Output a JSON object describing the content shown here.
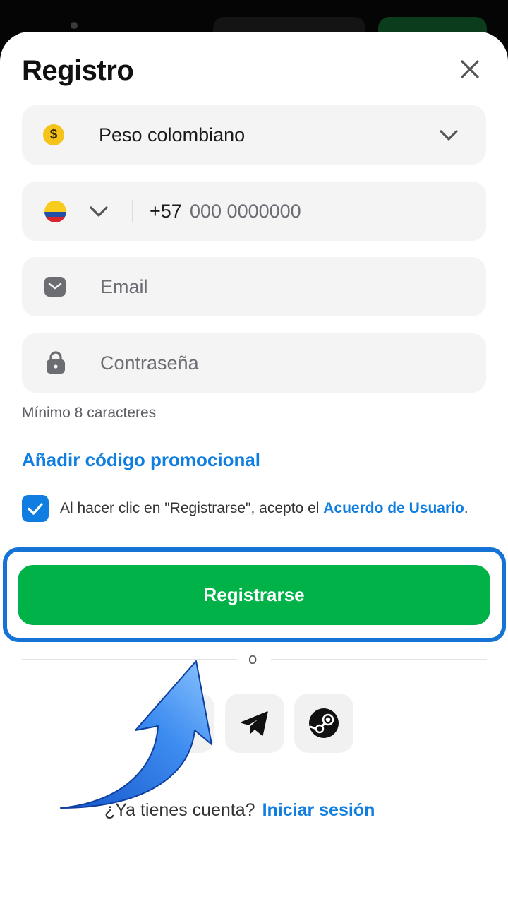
{
  "dialog": {
    "title": "Registro"
  },
  "currency": {
    "value": "Peso colombiano",
    "symbol": "$"
  },
  "phone": {
    "code": "+57",
    "placeholder": "000 0000000"
  },
  "email": {
    "placeholder": "Email"
  },
  "password": {
    "placeholder": "Contraseña",
    "hint": "Mínimo 8 caracteres"
  },
  "promo": {
    "label": "Añadir código promocional"
  },
  "terms": {
    "checked": true,
    "text": "Al hacer clic en \"Registrarse\", acepto el ",
    "link": "Acuerdo de Usuario",
    "end": "."
  },
  "register_button": {
    "label": "Registrarse"
  },
  "divider": {
    "text": "o"
  },
  "social": [
    "telegram-icon",
    "steam-icon"
  ],
  "login": {
    "question": "¿Ya tienes cuenta?",
    "link": "Iniciar sesión"
  },
  "colors": {
    "accent": "#0f7ee0",
    "primary_button": "#00b248",
    "highlight": "#1573d6"
  }
}
